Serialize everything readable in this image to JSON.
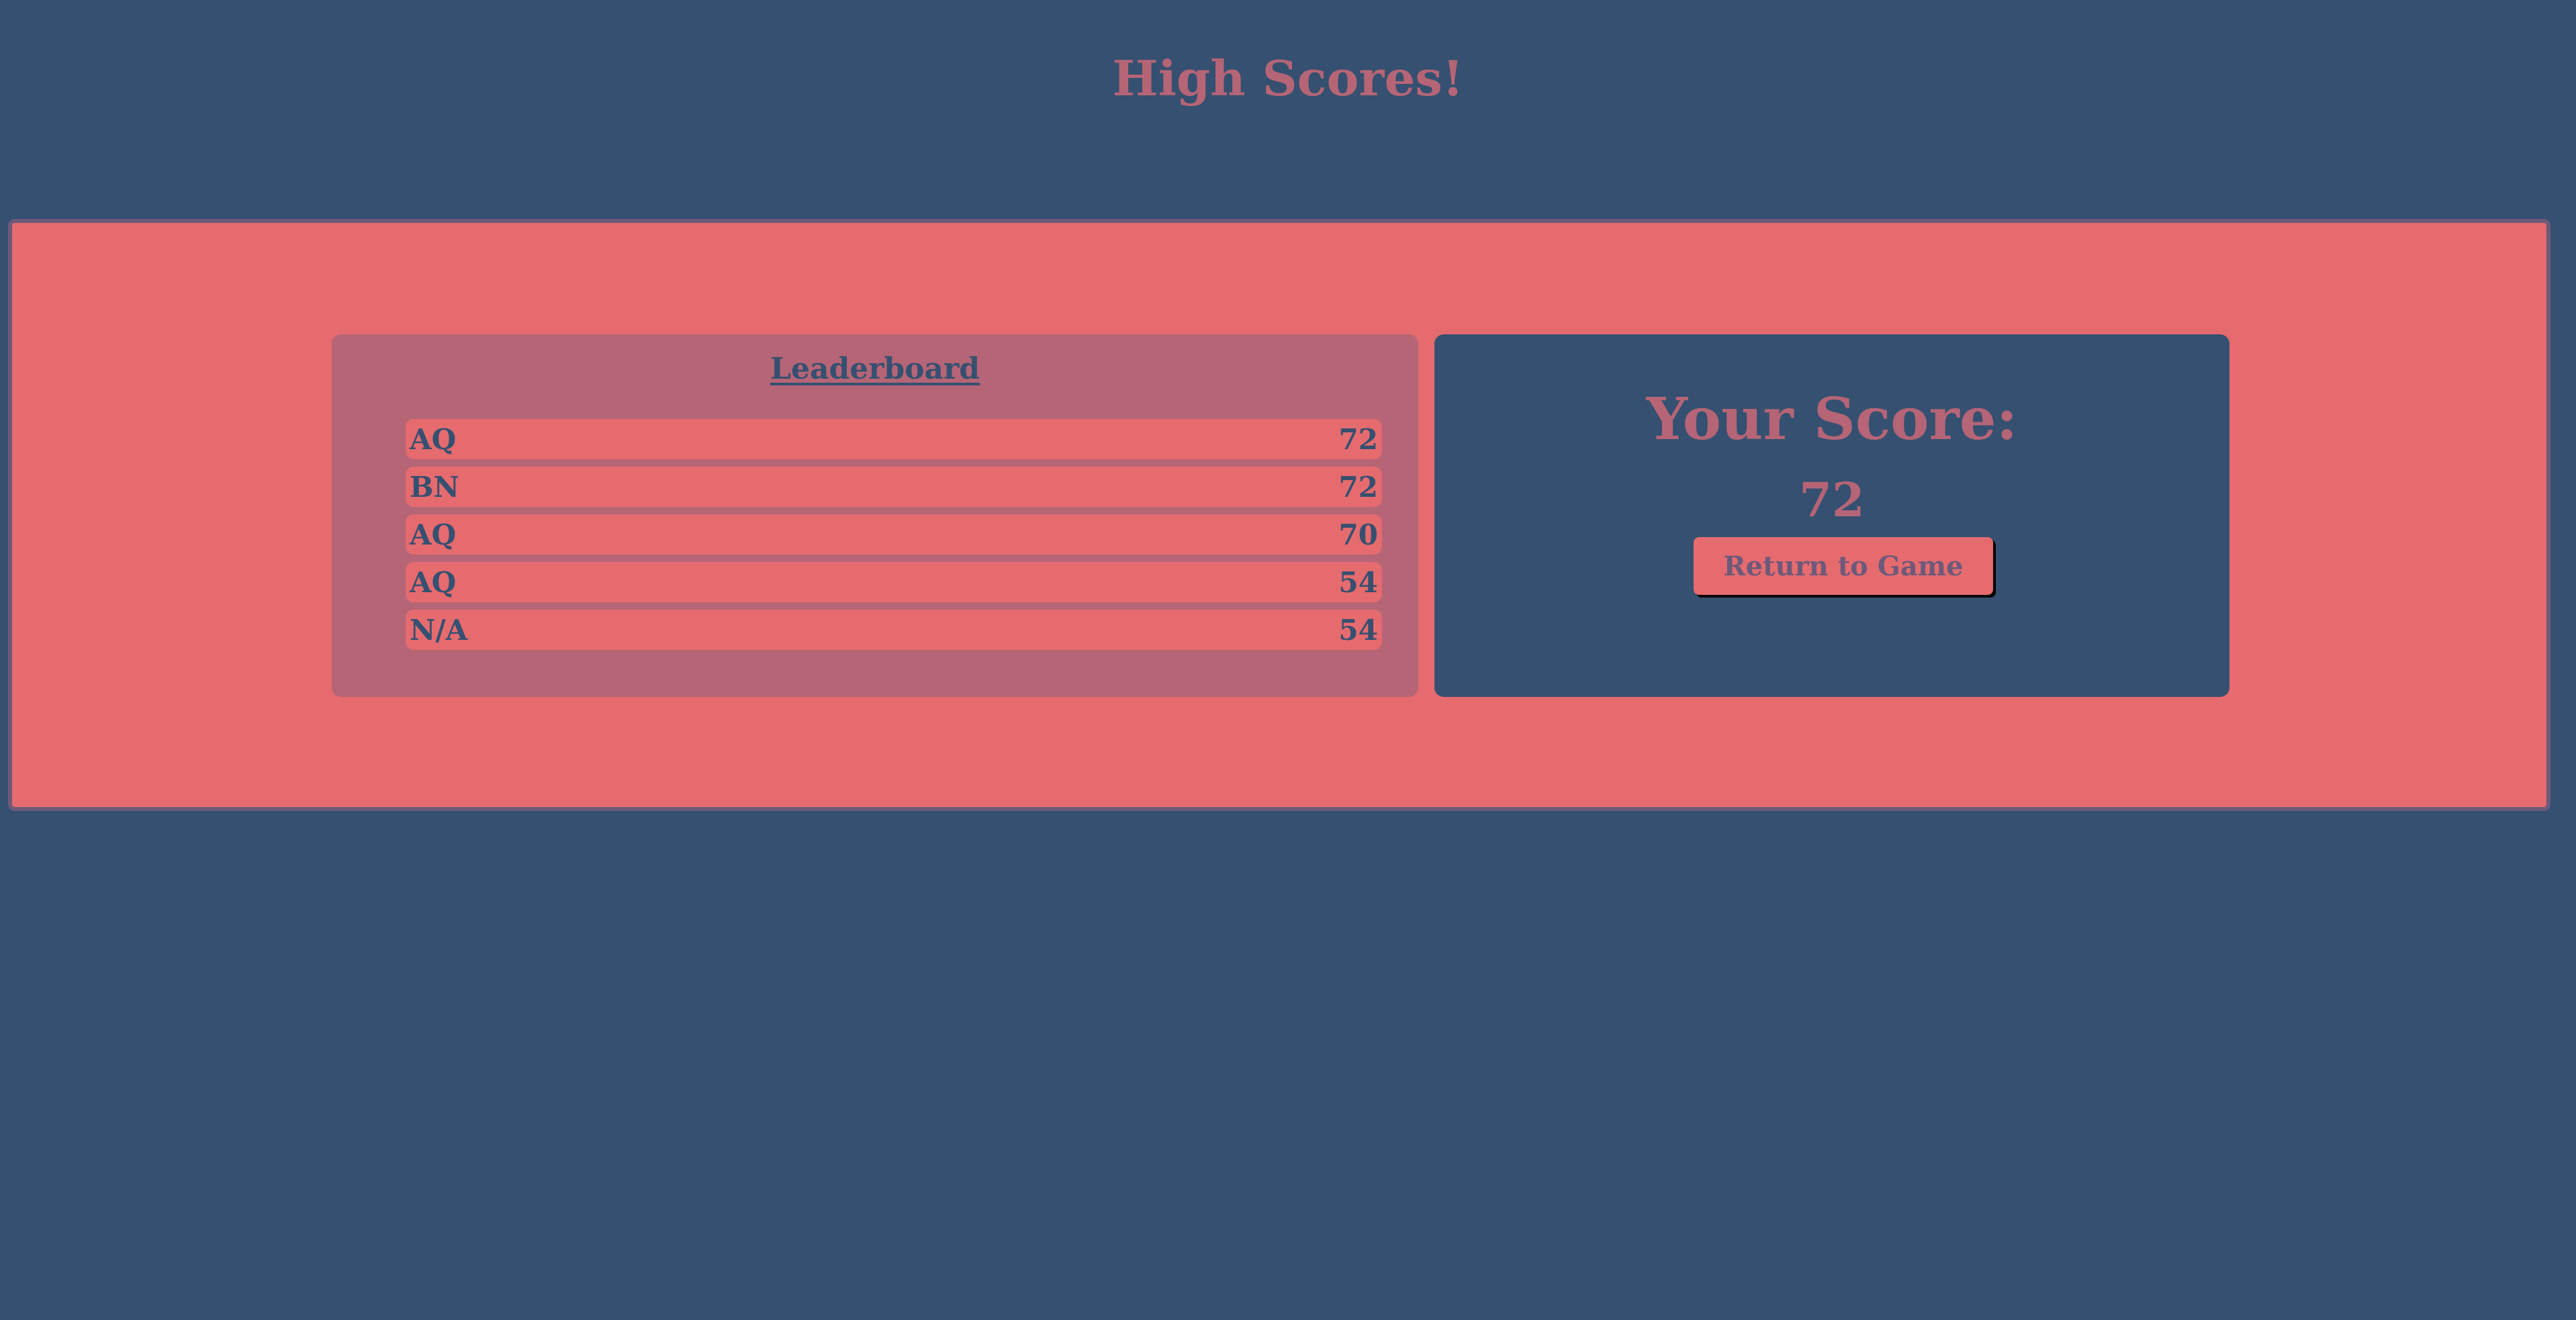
{
  "page": {
    "title": "High Scores!"
  },
  "colors": {
    "background": "#355070",
    "panel": "#e56b6f",
    "leaderboard_bg": "#b56576",
    "accent": "#6d597a"
  },
  "leaderboard": {
    "title": "Leaderboard",
    "entries": [
      {
        "name": "AQ",
        "score": "72"
      },
      {
        "name": "BN",
        "score": "72"
      },
      {
        "name": "AQ",
        "score": "70"
      },
      {
        "name": "AQ",
        "score": "54"
      },
      {
        "name": "N/A",
        "score": "54"
      }
    ]
  },
  "your_score": {
    "label": "Your Score:",
    "value": "72",
    "return_button_label": "Return to Game"
  }
}
